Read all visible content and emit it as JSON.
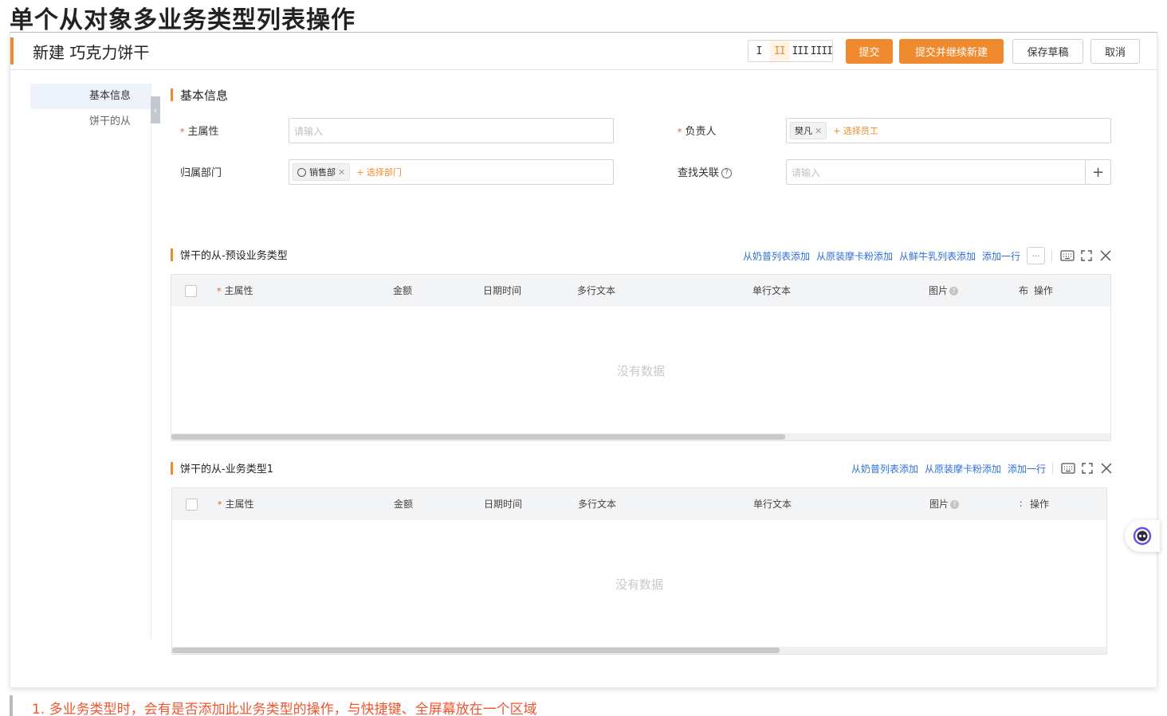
{
  "doc_title": "单个从对象多业务类型列表操作",
  "header": {
    "title": "新建 巧克力饼干",
    "column_switch": [
      "I",
      "II",
      "III",
      "IIII"
    ],
    "buttons": {
      "submit": "提交",
      "submit_continue": "提交并继续新建",
      "save_draft": "保存草稿",
      "cancel": "取消"
    }
  },
  "sidebar": {
    "items": [
      {
        "label": "基本信息"
      },
      {
        "label": "饼干的从"
      }
    ],
    "collapse_glyph": "‹"
  },
  "basic": {
    "title": "基本信息",
    "main_attr": {
      "label": "主属性",
      "placeholder": "请输入"
    },
    "owner": {
      "label": "负责人",
      "tag": "樊凡",
      "add": "+ 选择员工"
    },
    "dept": {
      "label": "归属部门",
      "tag": "销售部",
      "add": "+ 选择部门"
    },
    "lookup": {
      "label": "查找关联",
      "placeholder": "请输入"
    }
  },
  "table1": {
    "title": "饼干的从-预设业务类型",
    "actions": [
      "从奶普列表添加",
      "从原装摩卡粉添加",
      "从鲜牛乳列表添加",
      "添加一行"
    ],
    "more": "···",
    "columns": [
      "主属性",
      "金额",
      "日期时间",
      "多行文本",
      "单行文本",
      "图片",
      "布",
      "操作"
    ],
    "empty": "没有数据"
  },
  "table2": {
    "title": "饼干的从-业务类型1",
    "actions": [
      "从奶普列表添加",
      "从原装摩卡粉添加",
      "添加一行"
    ],
    "columns": [
      "主属性",
      "金额",
      "日期时间",
      "多行文本",
      "单行文本",
      "图片",
      "∶",
      "操作"
    ],
    "empty": "没有数据"
  },
  "note": "1. 多业务类型时，会有是否添加此业务类型的操作，与快捷键、全屏幕放在一个区域",
  "colors": {
    "accent": "#f08a2e",
    "link": "#2f6fd6",
    "note": "#f0552e"
  },
  "icons": [
    "keyboard-icon",
    "fullscreen-icon",
    "close-icon",
    "assistant-icon",
    "help-icon",
    "plus-icon"
  ]
}
